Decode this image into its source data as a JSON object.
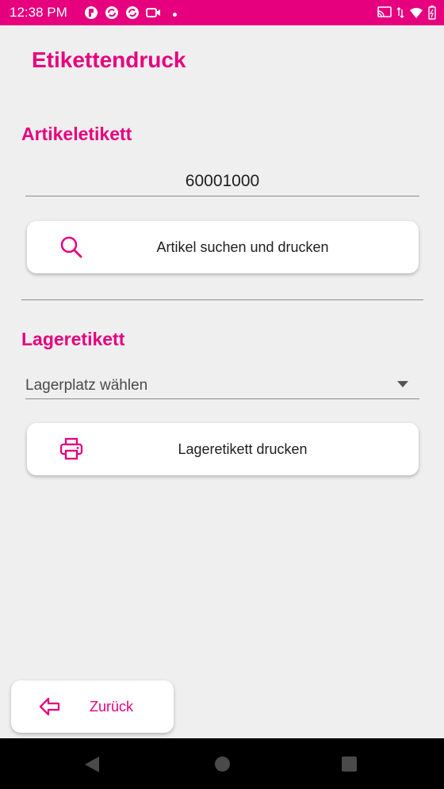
{
  "status_bar": {
    "time": "12:38 PM",
    "left_icons": [
      "app-notification-icon",
      "sync-icon",
      "sync-icon",
      "video-icon",
      "dot-icon"
    ],
    "right_icons": [
      "cast-icon",
      "data-arrows-icon",
      "wifi-icon",
      "battery-charging-icon"
    ]
  },
  "app": {
    "title": "Etikettendruck"
  },
  "article_section": {
    "title": "Artikeletikett",
    "article_number": "60001000",
    "search_button_label": "Artikel suchen und drucken",
    "search_button_icon": "search-icon"
  },
  "storage_section": {
    "title": "Lageretikett",
    "select_placeholder": "Lagerplatz wählen",
    "print_button_label": "Lageretikett drucken",
    "print_button_icon": "printer-icon"
  },
  "footer": {
    "back_label": "Zurück",
    "back_icon": "arrow-left-icon"
  },
  "colors": {
    "accent": "#e6007e",
    "background": "#efefef",
    "card": "#ffffff",
    "text": "#1e1e1e"
  }
}
